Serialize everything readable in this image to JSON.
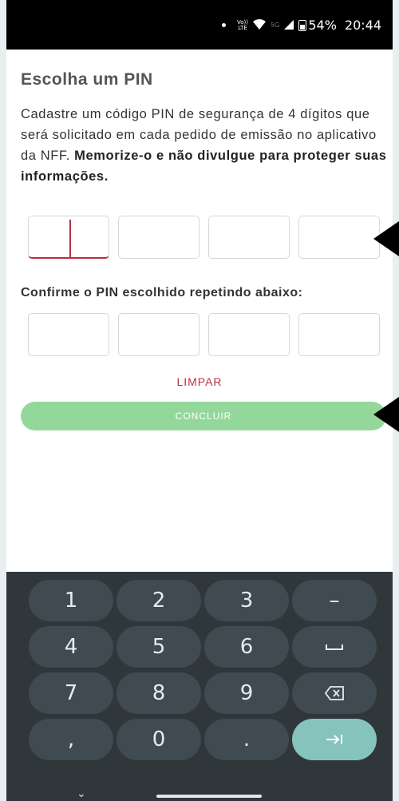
{
  "status_bar": {
    "volte": "Vo))\nLTE",
    "network_5g": "5G",
    "battery": "54%",
    "time": "20:44"
  },
  "page": {
    "title": "Escolha um PIN",
    "desc_normal": "Cadastre um código PIN de segurança de 4 dígitos que será solicitado em cada pedido de emissão no aplicativo da NFF. ",
    "desc_bold": "Memorize-o e não divulgue para proteger suas informações.",
    "pin_boxes": [
      "",
      "",
      "",
      ""
    ],
    "confirm_label": "Confirme o PIN escolhido repetindo abaixo:",
    "confirm_boxes": [
      "",
      "",
      "",
      ""
    ],
    "clear_label": "LIMPAR",
    "submit_label": "CONCLUIR"
  },
  "keyboard": {
    "rows": [
      [
        "1",
        "2",
        "3",
        "–"
      ],
      [
        "4",
        "5",
        "6",
        "space-icon"
      ],
      [
        "7",
        "8",
        "9",
        "backspace-icon"
      ],
      [
        ",",
        "0",
        ".",
        "next-icon"
      ]
    ]
  },
  "colors": {
    "accent": "#b9313c",
    "button_green": "#93d89a",
    "keyboard_bg": "#2f373b",
    "key_bg": "#3f4a51",
    "enter_key": "#86c3bc"
  }
}
